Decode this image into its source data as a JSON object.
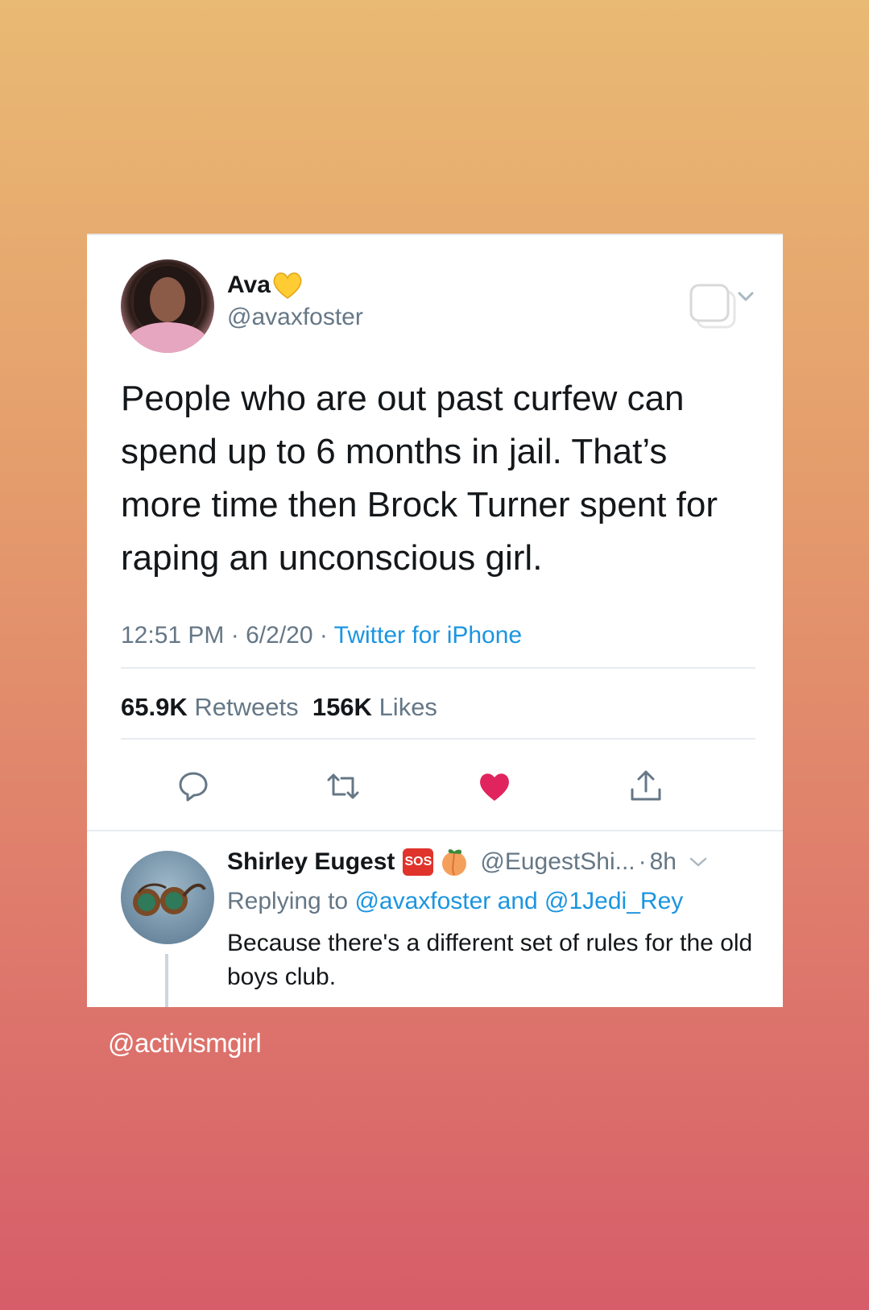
{
  "tweet": {
    "display_name": "Ava",
    "handle": "@avaxfoster",
    "text": "People who are out past curfew can spend up to 6 months in jail. That’s more time then Brock Turner spent for raping an unconscious girl.",
    "time": "12:51 PM",
    "date": "6/2/20",
    "separator": "·",
    "source": "Twitter for iPhone",
    "retweets_count": "65.9K",
    "retweets_label": "Retweets",
    "likes_count": "156K",
    "likes_label": "Likes",
    "liked": true
  },
  "reply": {
    "display_name": "Shirley Eugest",
    "badge": "SOS",
    "handle": "@EugestShi...",
    "time": "8h",
    "replying_prefix": "Replying to",
    "mention_1": "@avaxfoster",
    "conjunction": "and",
    "mention_2": "@1Jedi_Rey",
    "text": "Because there's a different set of rules for the old boys club."
  },
  "watermark": "@activismgirl",
  "colors": {
    "link": "#1b95e0",
    "like_heart": "#e0245e",
    "muted_text": "#657786",
    "heart_emoji": "#ffcc33"
  },
  "icons": [
    "heart-emoji-icon",
    "copy-icon",
    "chevron-down-icon",
    "reply-icon",
    "retweet-icon",
    "like-icon",
    "share-icon",
    "sos-badge-icon",
    "peach-emoji-icon"
  ]
}
